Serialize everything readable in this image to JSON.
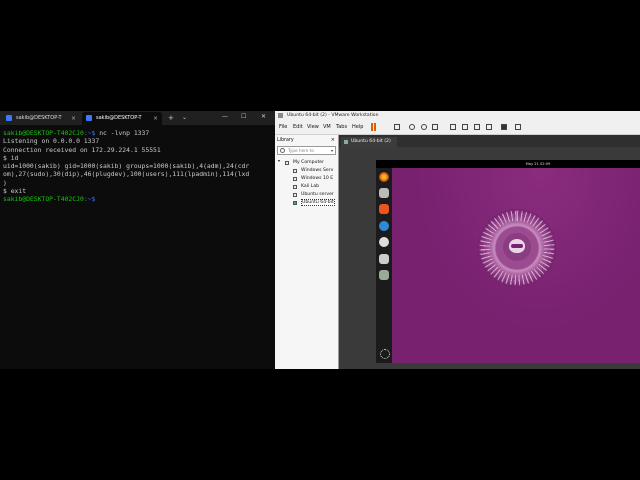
{
  "terminal": {
    "tabs": [
      {
        "label": "sakib@DESKTOP-T"
      },
      {
        "label": "sakib@DESKTOP-T"
      }
    ],
    "new_tab_label": "+",
    "dropdown_label": "⌄",
    "close_label": "×",
    "window_buttons": {
      "minimize": "—",
      "maximize": "☐",
      "close": "✕"
    },
    "prompt_user": "sakib@DESKTOP-T402CJ0",
    "prompt_path": ":~$",
    "lines": {
      "cmd1": " nc -lvnp 1337",
      "l2": "Listening on 0.0.0.0 1337",
      "l3": "Connection received on 172.29.224.1 55551",
      "l4": "$ id",
      "l5": "uid=1000(sakib) gid=1000(sakib) groups=1000(sakib),4(adm),24(cdr",
      "l6": "om),27(sudo),30(dip),46(plugdev),100(users),111(lpadmin),114(lxd",
      "l7": ")",
      "l8": "$ exit"
    }
  },
  "vmware": {
    "title": "Ubuntu 64-bit (2) - VMware Workstation",
    "menu": [
      "File",
      "Edit",
      "View",
      "VM",
      "Tabs",
      "Help"
    ],
    "library": {
      "title": "Library",
      "close": "×",
      "search_placeholder": "Type here to",
      "tree_root": "My Computer",
      "items": [
        "Windows Serv",
        "Windows 10 E",
        "Kali Lab",
        "Ubuntu server",
        "Ubuntu 64-bit"
      ]
    },
    "vm_tab_label": "Ubuntu 64-bit (2)",
    "guest_clock": "May 21 02:09"
  }
}
